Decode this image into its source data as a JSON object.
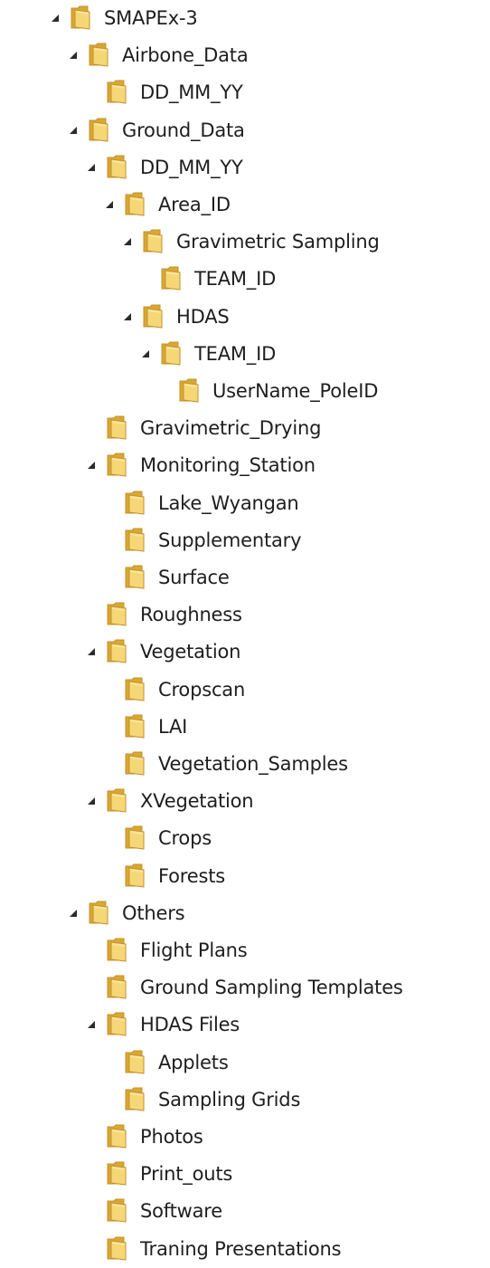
{
  "tree": {
    "items": [
      {
        "label": "SMAPEx-3",
        "depth": 0,
        "expanded": true,
        "icon": "folder-icon"
      },
      {
        "label": "Airbone_Data",
        "depth": 1,
        "expanded": true,
        "icon": "folder-icon"
      },
      {
        "label": "DD_MM_YY",
        "depth": 2,
        "expanded": false,
        "icon": "folder-icon"
      },
      {
        "label": "Ground_Data",
        "depth": 1,
        "expanded": true,
        "icon": "folder-icon"
      },
      {
        "label": "DD_MM_YY",
        "depth": 2,
        "expanded": true,
        "icon": "folder-icon"
      },
      {
        "label": "Area_ID",
        "depth": 3,
        "expanded": true,
        "icon": "folder-icon"
      },
      {
        "label": "Gravimetric Sampling",
        "depth": 4,
        "expanded": true,
        "icon": "folder-icon"
      },
      {
        "label": "TEAM_ID",
        "depth": 5,
        "expanded": false,
        "icon": "folder-icon"
      },
      {
        "label": "HDAS",
        "depth": 4,
        "expanded": true,
        "icon": "folder-icon"
      },
      {
        "label": "TEAM_ID",
        "depth": 5,
        "expanded": true,
        "icon": "folder-icon"
      },
      {
        "label": "UserName_PoleID",
        "depth": 6,
        "expanded": false,
        "icon": "folder-icon"
      },
      {
        "label": "Gravimetric_Drying",
        "depth": 2,
        "expanded": false,
        "icon": "folder-icon"
      },
      {
        "label": "Monitoring_Station",
        "depth": 2,
        "expanded": true,
        "icon": "folder-icon"
      },
      {
        "label": "Lake_Wyangan",
        "depth": 3,
        "expanded": false,
        "icon": "folder-icon"
      },
      {
        "label": "Supplementary",
        "depth": 3,
        "expanded": false,
        "icon": "folder-icon"
      },
      {
        "label": "Surface",
        "depth": 3,
        "expanded": false,
        "icon": "folder-icon"
      },
      {
        "label": "Roughness",
        "depth": 2,
        "expanded": false,
        "icon": "folder-icon"
      },
      {
        "label": "Vegetation",
        "depth": 2,
        "expanded": true,
        "icon": "folder-icon"
      },
      {
        "label": "Cropscan",
        "depth": 3,
        "expanded": false,
        "icon": "folder-icon"
      },
      {
        "label": "LAI",
        "depth": 3,
        "expanded": false,
        "icon": "folder-icon"
      },
      {
        "label": "Vegetation_Samples",
        "depth": 3,
        "expanded": false,
        "icon": "folder-icon"
      },
      {
        "label": "XVegetation",
        "depth": 2,
        "expanded": true,
        "icon": "folder-icon"
      },
      {
        "label": "Crops",
        "depth": 3,
        "expanded": false,
        "icon": "folder-icon"
      },
      {
        "label": "Forests",
        "depth": 3,
        "expanded": false,
        "icon": "folder-icon"
      },
      {
        "label": "Others",
        "depth": 1,
        "expanded": true,
        "icon": "folder-icon"
      },
      {
        "label": "Flight Plans",
        "depth": 2,
        "expanded": false,
        "icon": "folder-icon"
      },
      {
        "label": "Ground Sampling Templates",
        "depth": 2,
        "expanded": false,
        "icon": "folder-icon"
      },
      {
        "label": "HDAS Files",
        "depth": 2,
        "expanded": true,
        "icon": "folder-icon"
      },
      {
        "label": "Applets",
        "depth": 3,
        "expanded": false,
        "icon": "folder-icon"
      },
      {
        "label": "Sampling Grids",
        "depth": 3,
        "expanded": false,
        "icon": "folder-icon"
      },
      {
        "label": "Photos",
        "depth": 2,
        "expanded": false,
        "icon": "folder-icon"
      },
      {
        "label": "Print_outs",
        "depth": 2,
        "expanded": false,
        "icon": "folder-icon"
      },
      {
        "label": "Software",
        "depth": 2,
        "expanded": false,
        "icon": "folder-icon"
      },
      {
        "label": "Traning Presentations",
        "depth": 2,
        "expanded": false,
        "icon": "folder-icon"
      }
    ]
  },
  "colors": {
    "text": "#1e1e1e",
    "expander": "#2b2b2b",
    "folder_back": "#d9a833",
    "folder_front": "#f6d778",
    "folder_edge": "#c4922a"
  }
}
